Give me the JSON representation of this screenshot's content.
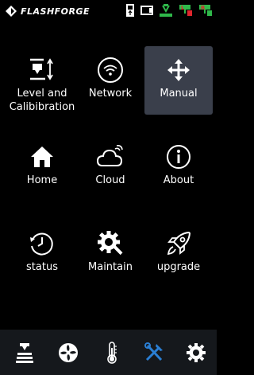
{
  "status_bar": {
    "brand": "FLASHFORGE",
    "icons": [
      "usb-icon",
      "camera-icon",
      "printer-head-temp-icon",
      "nozzle-left-temp-icon",
      "nozzle-right-temp-icon"
    ]
  },
  "menu": {
    "items": [
      {
        "label": "Level and Calibibration",
        "icon": "level-calibration-icon"
      },
      {
        "label": "Network",
        "icon": "wifi-icon"
      },
      {
        "label": "Manual",
        "icon": "move-arrows-icon",
        "active": true
      },
      {
        "label": "Home",
        "icon": "house-icon"
      },
      {
        "label": "Cloud",
        "icon": "cloud-icon"
      },
      {
        "label": "About",
        "icon": "info-icon"
      },
      {
        "label": "status",
        "icon": "clock-icon"
      },
      {
        "label": "Maintain",
        "icon": "maintain-gear-icon"
      },
      {
        "label": "upgrade",
        "icon": "rocket-icon"
      }
    ]
  },
  "tab_bar": {
    "tabs": [
      {
        "icon": "print-job-icon",
        "active": false
      },
      {
        "icon": "fan-icon",
        "active": false
      },
      {
        "icon": "thermometer-icon",
        "active": false
      },
      {
        "icon": "tools-icon",
        "active": true
      },
      {
        "icon": "settings-gear-icon",
        "active": false
      }
    ],
    "active_color": "#2a7fd4",
    "inactive_color": "#ffffff"
  },
  "colors": {
    "background": "#000000",
    "active_tile": "#3a3f4b",
    "tab_bar_bg": "#15181c"
  }
}
